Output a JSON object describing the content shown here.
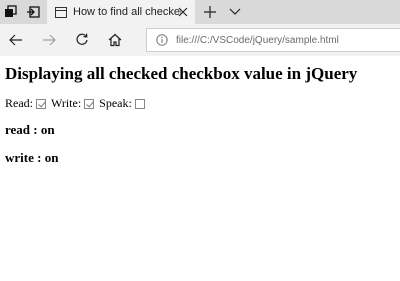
{
  "browser": {
    "tab": {
      "title": "How to find all checked"
    },
    "address_bar": {
      "url": "file:///C:/VSCode/jQuery/sample.html"
    }
  },
  "page": {
    "heading": "Displaying all checked checkbox value in jQuery",
    "checkboxes": [
      {
        "label": "Read:",
        "checked": true
      },
      {
        "label": "Write:",
        "checked": true
      },
      {
        "label": "Speak:",
        "checked": false
      }
    ],
    "results": [
      "read : on",
      "write : on"
    ]
  }
}
